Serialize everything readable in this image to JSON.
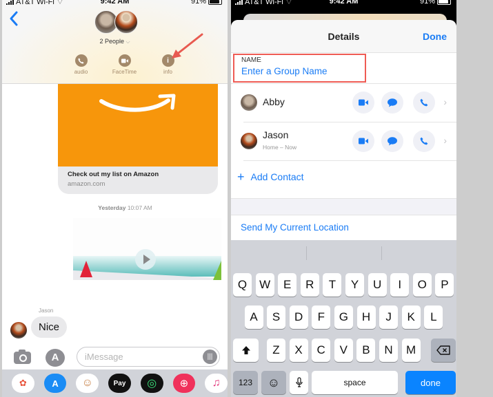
{
  "left_phone": {
    "status": {
      "carrier": "AT&T Wi-Fi",
      "time": "9:42 AM",
      "battery": "91%"
    },
    "header": {
      "people_label": "2 People",
      "actions": [
        {
          "label": "audio",
          "icon": "phone-icon"
        },
        {
          "label": "FaceTime",
          "icon": "video-icon"
        },
        {
          "label": "info",
          "icon": "info-icon",
          "glyph": "i"
        }
      ]
    },
    "messages": {
      "link_preview": {
        "title": "Check out my list on Amazon",
        "domain": "amazon.com",
        "image_color": "#f7960b"
      },
      "timestamp_day": "Yesterday",
      "timestamp_time": "10:07 AM",
      "sender_name": "Jason",
      "received_text": "Nice"
    },
    "compose": {
      "placeholder": "iMessage"
    },
    "app_drawer": [
      {
        "name": "photos-app",
        "glyph": "✿",
        "bg": "#ffffff",
        "fg": "#e8553d"
      },
      {
        "name": "app-store-app",
        "glyph": "A",
        "bg": "#1a8cf5",
        "fg": "#ffffff"
      },
      {
        "name": "memoji-app",
        "glyph": "☺",
        "bg": "#ffffff",
        "fg": "#c57b3e"
      },
      {
        "name": "apple-pay-app",
        "glyph": "Pay",
        "bg": "#111111",
        "fg": "#ffffff"
      },
      {
        "name": "activity-app",
        "glyph": "◎",
        "bg": "#111111",
        "fg": "#3be37a"
      },
      {
        "name": "web-search-app",
        "glyph": "⊕",
        "bg": "#f0315b",
        "fg": "#ffffff"
      },
      {
        "name": "music-app",
        "glyph": "♫",
        "bg": "#ffffff",
        "fg": "#e33c7f"
      }
    ]
  },
  "right_phone": {
    "status": {
      "carrier": "AT&T Wi-Fi",
      "time": "9:42 AM",
      "battery": "91%"
    },
    "sheet": {
      "title": "Details",
      "done_label": "Done"
    },
    "name_field": {
      "label": "NAME",
      "placeholder": "Enter a Group Name"
    },
    "contacts": [
      {
        "name": "Abby",
        "subtitle": ""
      },
      {
        "name": "Jason",
        "subtitle": "Home – Now"
      }
    ],
    "add_contact_label": "Add Contact",
    "send_location_label": "Send My Current Location",
    "keyboard": {
      "row1": [
        "Q",
        "W",
        "E",
        "R",
        "T",
        "Y",
        "U",
        "I",
        "O",
        "P"
      ],
      "row2": [
        "A",
        "S",
        "D",
        "F",
        "G",
        "H",
        "J",
        "K",
        "L"
      ],
      "row3": [
        "Z",
        "X",
        "C",
        "V",
        "B",
        "N",
        "M"
      ],
      "numbers_label": "123",
      "space_label": "space",
      "done_label": "done"
    }
  }
}
